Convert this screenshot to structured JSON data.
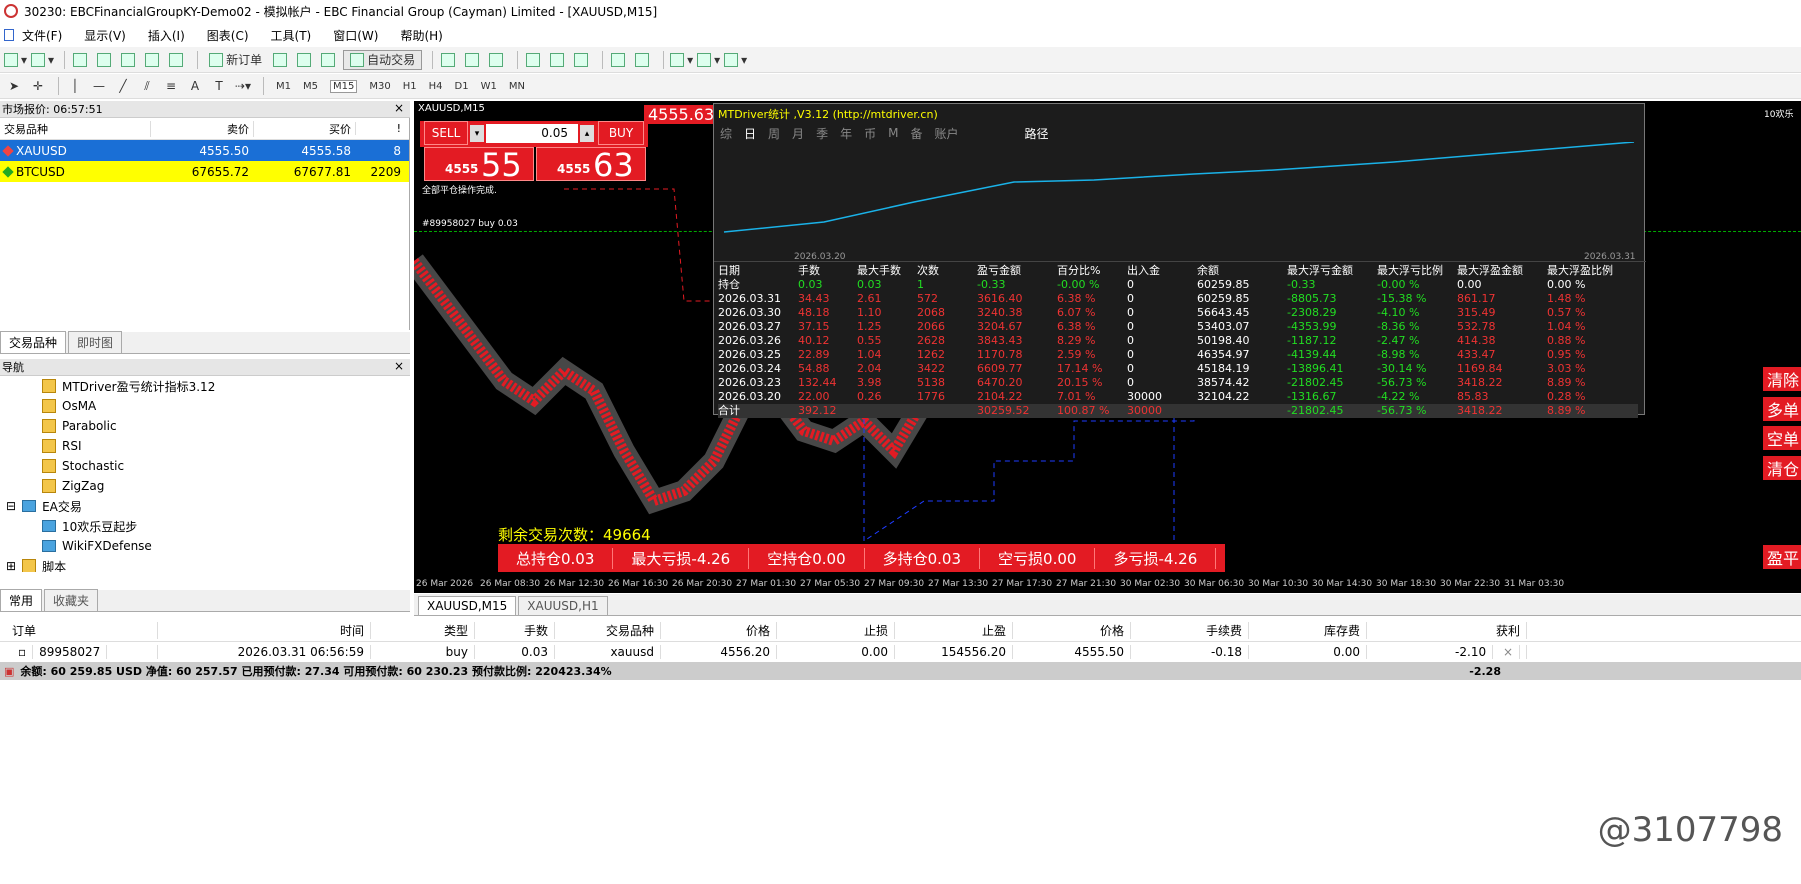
{
  "window": {
    "title": "30230: EBCFinancialGroupKY-Demo02 - 模拟帐户 - EBC Financial Group (Cayman) Limited - [XAUUSD,M15]"
  },
  "menu": [
    "文件(F)",
    "显示(V)",
    "插入(I)",
    "图表(C)",
    "工具(T)",
    "窗口(W)",
    "帮助(H)"
  ],
  "toolbar": {
    "new_order": "新订单",
    "auto_trade": "自动交易"
  },
  "timeframes": [
    "M1",
    "M5",
    "M15",
    "M30",
    "H1",
    "H4",
    "D1",
    "W1",
    "MN"
  ],
  "market_watch": {
    "title": "市场报价: 06:57:51",
    "headers": [
      "交易品种",
      "卖价",
      "买价",
      "!"
    ],
    "rows": [
      {
        "symbol": "XAUUSD",
        "bid": "4555.50",
        "ask": "4555.58",
        "spread": "8"
      },
      {
        "symbol": "BTCUSD",
        "bid": "67655.72",
        "ask": "67677.81",
        "spread": "2209"
      }
    ],
    "tabs": [
      "交易品种",
      "即时图"
    ]
  },
  "navigator": {
    "title": "导航",
    "items": [
      "MTDriver盈亏统计指标3.12",
      "OsMA",
      "Parabolic",
      "RSI",
      "Stochastic",
      "ZigZag",
      "EA交易",
      "10欢乐豆起步",
      "WikiFXDefense",
      "脚本"
    ],
    "tabs": [
      "常用",
      "收藏夹"
    ]
  },
  "chart": {
    "symbol": "XAUUSD,M15",
    "one_click": {
      "sell": "SELL",
      "buy": "BUY",
      "volume": "0.05",
      "sell_small": "4555",
      "sell_big": "55",
      "buy_small": "4555",
      "buy_big": "63",
      "price_tag": "4555.63"
    },
    "messages": {
      "close_done": "全部平仓操作完成.",
      "order_line": "#89958027 buy 0.03"
    },
    "remaining": "剩余交易次数：49664",
    "stats": [
      "总持仓0.03",
      "最大亏损-4.26",
      "空持仓0.00",
      "多持仓0.03",
      "空亏损0.00",
      "多亏损-4.26"
    ],
    "right_buttons": [
      "清除",
      "多单",
      "空单",
      "清仓",
      "盈平"
    ],
    "corner_text": "10欢乐",
    "time_labels": [
      "26 Mar 2026",
      "26 Mar 08:30",
      "26 Mar 12:30",
      "26 Mar 16:30",
      "26 Mar 20:30",
      "27 Mar 01:30",
      "27 Mar 05:30",
      "27 Mar 09:30",
      "27 Mar 13:30",
      "27 Mar 17:30",
      "27 Mar 21:30",
      "30 Mar 02:30",
      "30 Mar 06:30",
      "30 Mar 10:30",
      "30 Mar 14:30",
      "30 Mar 18:30",
      "30 Mar 22:30",
      "31 Mar 03:30"
    ],
    "tabs": [
      "XAUUSD,M15",
      "XAUUSD,H1"
    ]
  },
  "mtdriver": {
    "title": "MTDriver统计 ,V3.12 (http://mtdriver.cn)",
    "periods": [
      "综",
      "日",
      "周",
      "月",
      "季",
      "年",
      "币",
      "M",
      "备",
      "账户"
    ],
    "active_period": "日",
    "path_label": "路径",
    "date_start": "2026.03.20",
    "date_end": "2026.03.31",
    "headers": [
      "日期",
      "手数",
      "最大手数",
      "次数",
      "盈亏金额",
      "百分比%",
      "出入金",
      "余额",
      "最大浮亏金额",
      "最大浮亏比例",
      "最大浮盈金额",
      "最大浮盈比例"
    ],
    "position_row": [
      "持仓",
      "0.03",
      "0.03",
      "1",
      "-0.33",
      "-0.00 %",
      "0",
      "60259.85",
      "-0.33",
      "-0.00 %",
      "0.00",
      "0.00 %"
    ],
    "rows": [
      [
        "2026.03.31",
        "34.43",
        "2.61",
        "572",
        "3616.40",
        "6.38 %",
        "0",
        "60259.85",
        "-8805.73",
        "-15.38 %",
        "861.17",
        "1.48 %"
      ],
      [
        "2026.03.30",
        "48.18",
        "1.10",
        "2068",
        "3240.38",
        "6.07 %",
        "0",
        "56643.45",
        "-2308.29",
        "-4.10 %",
        "315.49",
        "0.57 %"
      ],
      [
        "2026.03.27",
        "37.15",
        "1.25",
        "2066",
        "3204.67",
        "6.38 %",
        "0",
        "53403.07",
        "-4353.99",
        "-8.36 %",
        "532.78",
        "1.04 %"
      ],
      [
        "2026.03.26",
        "40.12",
        "0.55",
        "2628",
        "3843.43",
        "8.29 %",
        "0",
        "50198.40",
        "-1187.12",
        "-2.47 %",
        "414.38",
        "0.88 %"
      ],
      [
        "2026.03.25",
        "22.89",
        "1.04",
        "1262",
        "1170.78",
        "2.59 %",
        "0",
        "46354.97",
        "-4139.44",
        "-8.98 %",
        "433.47",
        "0.95 %"
      ],
      [
        "2026.03.24",
        "54.88",
        "2.04",
        "3422",
        "6609.77",
        "17.14 %",
        "0",
        "45184.19",
        "-13896.41",
        "-30.14 %",
        "1169.84",
        "3.03 %"
      ],
      [
        "2026.03.23",
        "132.44",
        "3.98",
        "5138",
        "6470.20",
        "20.15 %",
        "0",
        "38574.42",
        "-21802.45",
        "-56.73 %",
        "3418.22",
        "8.89 %"
      ],
      [
        "2026.03.20",
        "22.00",
        "0.26",
        "1776",
        "2104.22",
        "7.01 %",
        "30000",
        "32104.22",
        "-1316.67",
        "-4.22 %",
        "85.83",
        "0.28 %"
      ]
    ],
    "total_row": [
      "合计",
      "392.12",
      "",
      "",
      "30259.52",
      "100.87 %",
      "30000",
      "",
      "-21802.45",
      "-56.73 %",
      "3418.22",
      "8.89 %"
    ]
  },
  "terminal": {
    "headers": [
      "订单",
      "时间",
      "类型",
      "手数",
      "交易品种",
      "价格",
      "止损",
      "止盈",
      "价格",
      "手续费",
      "库存费",
      "获利"
    ],
    "order": [
      "89958027",
      "2026.03.31 06:56:59",
      "buy",
      "0.03",
      "xauusd",
      "4556.20",
      "0.00",
      "154556.20",
      "4555.50",
      "-0.18",
      "0.00",
      "-2.10"
    ],
    "balance": "余额: 60 259.85 USD  净值: 60 257.57  已用预付款: 27.34  可用预付款: 60 230.23  预付款比例: 220423.34%",
    "total_profit": "-2.28"
  },
  "watermark": "@3107798"
}
